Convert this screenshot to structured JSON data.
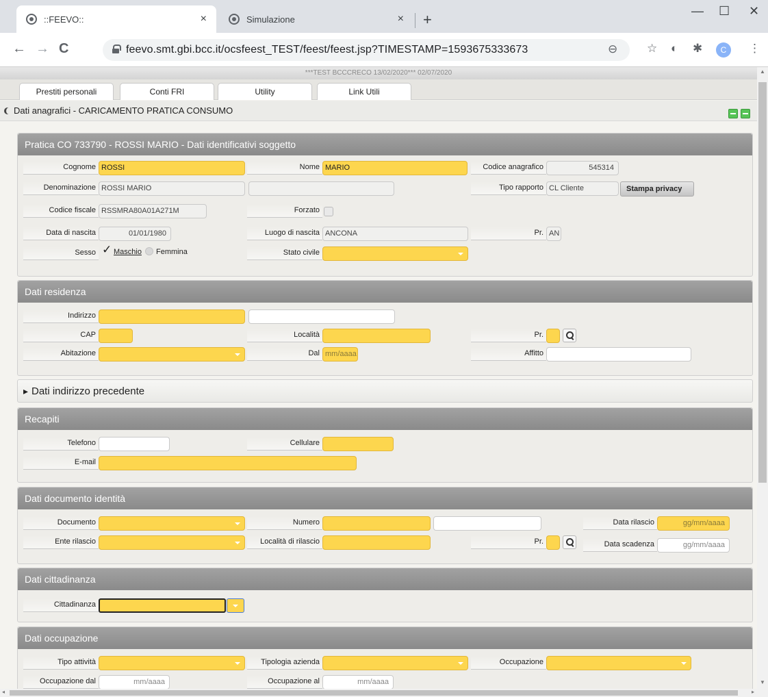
{
  "browser": {
    "tabs": [
      {
        "title": "::FEEVO::",
        "close": "×"
      },
      {
        "title": "Simulazione",
        "close": "×"
      }
    ],
    "new_tab": "+",
    "window_controls": {
      "minimize": "—",
      "maximize": "☐",
      "close": "✕"
    },
    "nav": {
      "back": "←",
      "forward": "→",
      "reload": "C"
    },
    "url": "feevo.smt.gbi.bcc.it/ocsfeest_TEST/feest/feest.jsp?TIMESTAMP=1593675333673",
    "toolbar_icons": {
      "zoom": "⊖",
      "star": "☆",
      "ext1": "◐",
      "ext2": "✱",
      "menu": "⋮"
    },
    "profile_initial": "C"
  },
  "env_banner": "***TEST BCCCRECO 13/02/2020***  02/07/2020",
  "app_tabs": [
    "Prestiti personali",
    "Conti FRI",
    "Utility",
    "Link Utili"
  ],
  "section_title": "Dati anagrafici - CARICAMENTO PRATICA CONSUMO",
  "identificativi": {
    "header": "Pratica CO 733790 - ROSSI MARIO - Dati identificativi soggetto",
    "cognome_label": "Cognome",
    "cognome": "ROSSI",
    "nome_label": "Nome",
    "nome": "MARIO",
    "codice_anagrafico_label": "Codice anagrafico",
    "codice_anagrafico": "545314",
    "denominazione_label": "Denominazione",
    "denominazione": "ROSSI MARIO",
    "tipo_rapporto_label": "Tipo rapporto",
    "tipo_rapporto": "CL Cliente",
    "stampa_privacy": "Stampa privacy",
    "codice_fiscale_label": "Codice fiscale",
    "codice_fiscale": "RSSMRA80A01A271M",
    "forzato_label": "Forzato",
    "data_nascita_label": "Data di nascita",
    "data_nascita": "01/01/1980",
    "luogo_nascita_label": "Luogo di nascita",
    "luogo_nascita": "ANCONA",
    "pr_label": "Pr.",
    "pr": "AN",
    "sesso_label": "Sesso",
    "maschio": "Maschio",
    "femmina": "Femmina",
    "check": "✓",
    "stato_civile_label": "Stato civile"
  },
  "residenza": {
    "header": "Dati residenza",
    "indirizzo_label": "Indirizzo",
    "cap_label": "CAP",
    "localita_label": "Località",
    "pr_label": "Pr.",
    "abitazione_label": "Abitazione",
    "dal_label": "Dal",
    "dal_placeholder": "mm/aaaa",
    "affitto_label": "Affitto"
  },
  "indirizzo_precedente": {
    "header": "Dati indirizzo precedente"
  },
  "recapiti": {
    "header": "Recapiti",
    "telefono_label": "Telefono",
    "cellulare_label": "Cellulare",
    "email_label": "E-mail"
  },
  "documento": {
    "header": "Dati documento identità",
    "documento_label": "Documento",
    "numero_label": "Numero",
    "data_rilascio_label": "Data rilascio",
    "data_rilascio_placeholder": "gg/mm/aaaa",
    "ente_rilascio_label": "Ente rilascio",
    "localita_rilascio_label": "Località di rilascio",
    "pr_label": "Pr.",
    "data_scadenza_label": "Data scadenza",
    "data_scadenza_placeholder": "gg/mm/aaaa"
  },
  "cittadinanza": {
    "header": "Dati cittadinanza",
    "label": "Cittadinanza"
  },
  "occupazione": {
    "header": "Dati occupazione",
    "tipo_attivita_label": "Tipo attività",
    "tipologia_azienda_label": "Tipologia azienda",
    "occupazione_label": "Occupazione",
    "occupazione_dal_label": "Occupazione dal",
    "occupazione_dal_placeholder": "mm/aaaa",
    "occupazione_al_label": "Occupazione al",
    "occupazione_al_placeholder": "mm/aaaa"
  }
}
